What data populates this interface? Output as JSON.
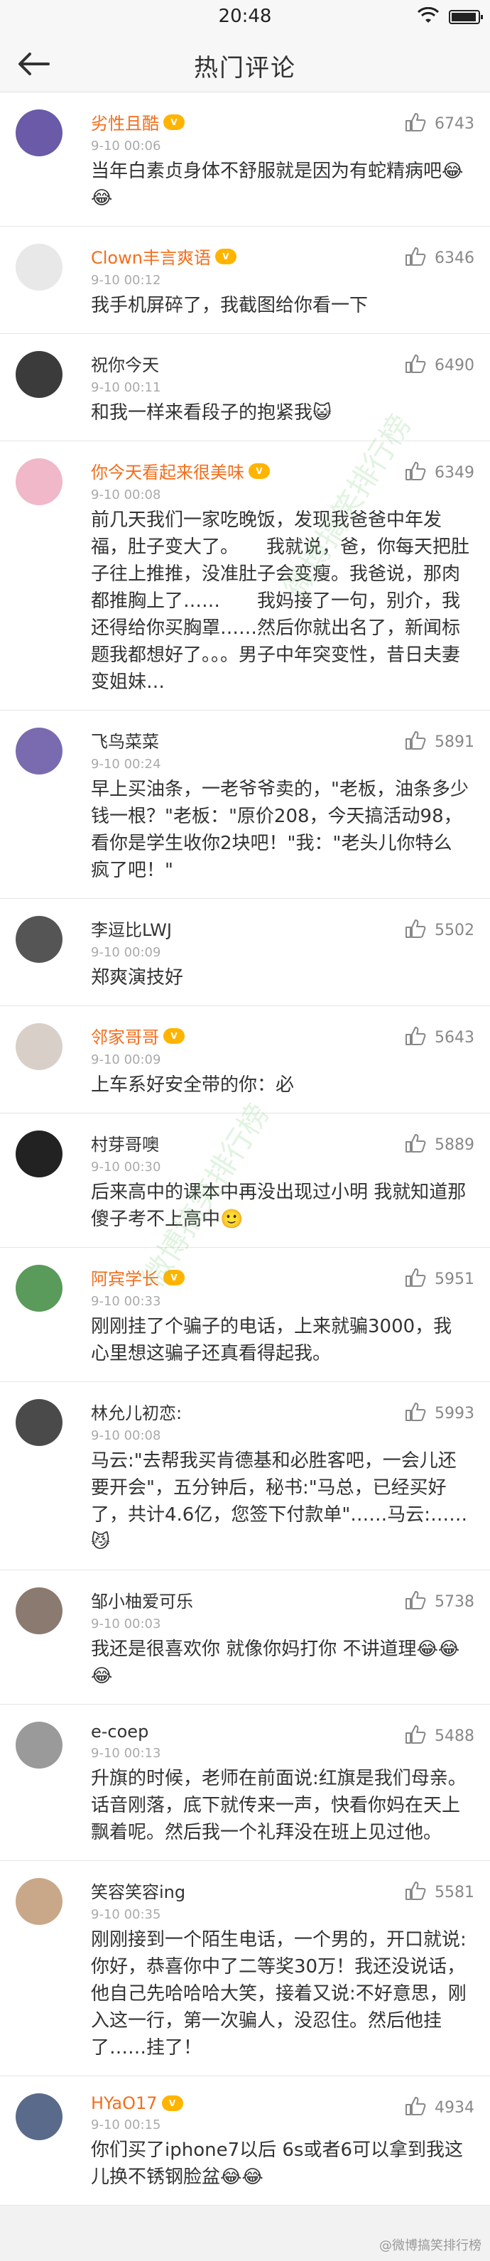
{
  "status": {
    "time": "20:48"
  },
  "nav": {
    "title": "热门评论"
  },
  "comments": [
    {
      "name": "劣性且酷",
      "vip": true,
      "time": "9-10 00:06",
      "likes": "6743",
      "text": "当年白素贞身体不舒服就是因为有蛇精病吧😂😂",
      "avatar_color": "#6a5aa8"
    },
    {
      "name": "Clown丰言爽语",
      "vip": true,
      "time": "9-10 00:12",
      "likes": "6346",
      "text": "我手机屏碎了，我截图给你看一下",
      "avatar_color": "#e8e8e8"
    },
    {
      "name": "祝你今天",
      "vip": false,
      "time": "9-10 00:11",
      "likes": "6490",
      "text": "和我一样来看段子的抱紧我😺",
      "avatar_color": "#3b3b3b"
    },
    {
      "name": "你今天看起来很美味",
      "vip": true,
      "time": "9-10 00:08",
      "likes": "6349",
      "text": "前几天我们一家吃晚饭，发现我爸爸中年发福，肚子变大了。　　我就说，爸，你每天把肚子往上推推，没准肚子会变瘦。我爸说，那肉都推胸上了……　　我妈接了一句，别介，我还得给你买胸罩……然后你就出名了，新闻标题我都想好了。。。男子中年突变性，昔日夫妻变姐妹…",
      "avatar_color": "#f0b8c8"
    },
    {
      "name": "飞鸟菜菜",
      "vip": false,
      "time": "9-10 00:24",
      "likes": "5891",
      "text": "早上买油条，一老爷爷卖的，\"老板，油条多少钱一根？\"老板：\"原价208，今天搞活动98，看你是学生收你2块吧！\"我：\"老头儿你特么疯了吧！\"",
      "avatar_color": "#7a6bb0"
    },
    {
      "name": "李逗比LWJ",
      "vip": false,
      "time": "9-10 00:09",
      "likes": "5502",
      "text": "郑爽演技好",
      "avatar_color": "#555555"
    },
    {
      "name": "邻家哥哥",
      "vip": true,
      "time": "9-10 00:09",
      "likes": "5643",
      "text": "上车系好安全带的你：必",
      "avatar_color": "#d8d0c8"
    },
    {
      "name": "村芽哥噢",
      "vip": false,
      "time": "9-10 00:30",
      "likes": "5889",
      "text": "后来高中的课本中再没出现过小明 我就知道那傻子考不上高中🙂",
      "avatar_color": "#222222"
    },
    {
      "name": "阿宾学长",
      "vip": true,
      "time": "9-10 00:33",
      "likes": "5951",
      "text": "刚刚挂了个骗子的电话，上来就骗3000，我心里想这骗子还真看得起我。",
      "avatar_color": "#5a9a5a"
    },
    {
      "name": "林允儿初恋:",
      "vip": false,
      "time": "9-10 00:08",
      "likes": "5993",
      "text": "马云:\"去帮我买肯德基和必胜客吧，一会儿还要开会\"，五分钟后，秘书:\"马总，已经买好了，共计4.6亿，您签下付款单\"……马云:……😼",
      "avatar_color": "#4a4a4a"
    },
    {
      "name": "邹小柚爱可乐",
      "vip": false,
      "time": "9-10 00:03",
      "likes": "5738",
      "text": "我还是很喜欢你 就像你妈打你 不讲道理😂😂😂",
      "avatar_color": "#8a7a70"
    },
    {
      "name": "e-coep",
      "vip": false,
      "time": "9-10 00:13",
      "likes": "5488",
      "text": "升旗的时候，老师在前面说:红旗是我们母亲。 话音刚落，底下就传来一声，快看你妈在天上飘着呢。然后我一个礼拜没在班上见过他。",
      "avatar_color": "#9a9a9a"
    },
    {
      "name": "笑容笑容ing",
      "vip": false,
      "time": "9-10 00:35",
      "likes": "5581",
      "text": "刚刚接到一个陌生电话，一个男的，开口就说:你好，恭喜你中了二等奖30万！我还没说话，他自己先哈哈哈大笑，接着又说:不好意思，刚入这一行，第一次骗人，没忍住。然后他挂了……挂了！",
      "avatar_color": "#c8a888"
    },
    {
      "name": "HYaO17",
      "vip": true,
      "time": "9-10 00:15",
      "likes": "4934",
      "text": "你们买了iphone7以后 6s或者6可以拿到我这儿换不锈钢脸盆😂😂",
      "avatar_color": "#5a6a8a"
    }
  ],
  "watermark": {
    "text": "微博搞笑排行榜"
  },
  "footer": {
    "text": "@微博搞笑排行榜"
  }
}
